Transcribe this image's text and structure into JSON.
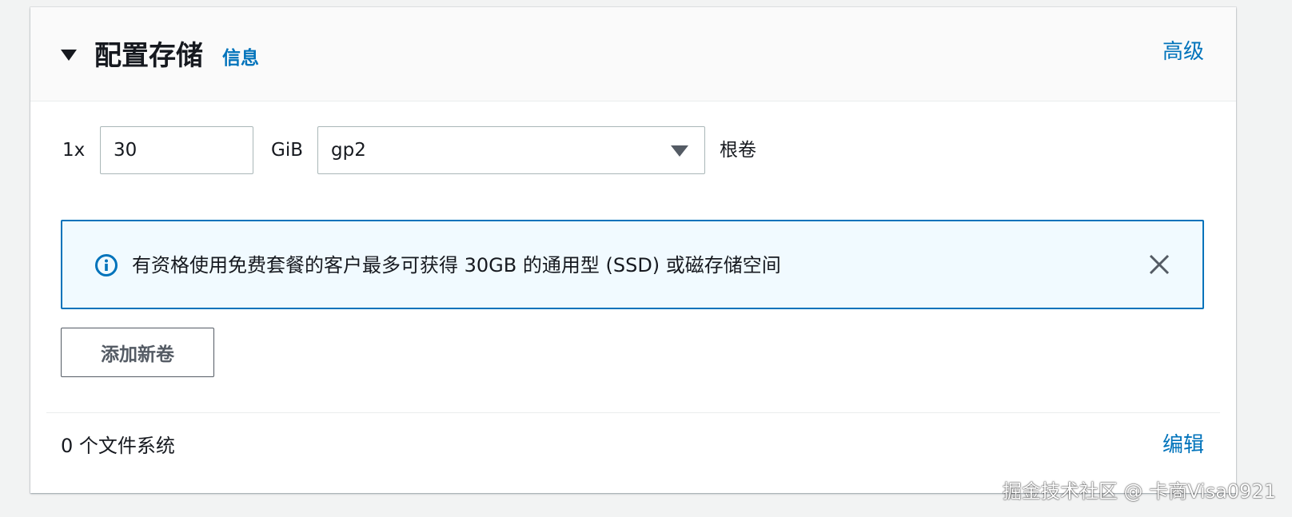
{
  "section": {
    "title": "配置存储",
    "info_link": "信息",
    "advanced_link": "高级"
  },
  "volume": {
    "count_label": "1x",
    "size_value": "30",
    "size_unit": "GiB",
    "type_selected": "gp2",
    "volume_label": "根卷"
  },
  "alert": {
    "type": "info",
    "text": "有资格使用免费套餐的客户最多可获得 30GB 的通用型 (SSD) 或磁存储空间",
    "icon": "info-circle-icon",
    "dismiss_icon": "close-icon"
  },
  "actions": {
    "add_volume_label": "添加新卷"
  },
  "file_systems": {
    "count_text": "0 个文件系统",
    "edit_link": "编辑"
  },
  "watermark": {
    "text": "掘金技术社区 @ 卡商Visa0921"
  },
  "colors": {
    "link": "#0073bb",
    "alert_border": "#0073bb",
    "alert_background": "#f1faff",
    "text": "#16191f",
    "header_background": "#fafafa",
    "page_background": "#f2f3f3"
  }
}
